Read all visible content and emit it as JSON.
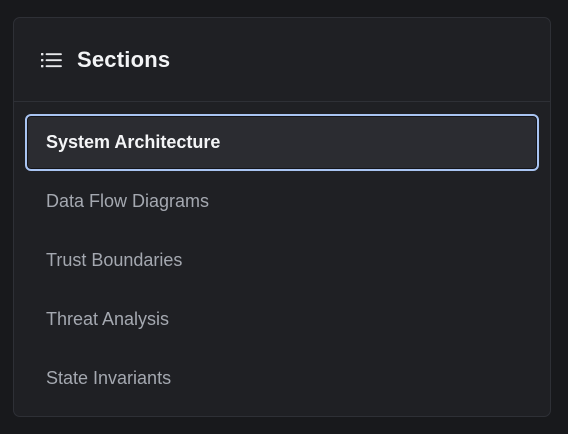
{
  "panel": {
    "title": "Sections",
    "icon": "list-icon"
  },
  "sections": [
    {
      "label": "System Architecture",
      "active": true
    },
    {
      "label": "Data Flow Diagrams",
      "active": false
    },
    {
      "label": "Trust Boundaries",
      "active": false
    },
    {
      "label": "Threat Analysis",
      "active": false
    },
    {
      "label": "State Invariants",
      "active": false
    }
  ],
  "colors": {
    "background": "#18191c",
    "panel": "#1f2024",
    "active_border": "#a9c4f2",
    "text_muted": "#a4a8b0",
    "text_active": "#f4f5f7"
  }
}
